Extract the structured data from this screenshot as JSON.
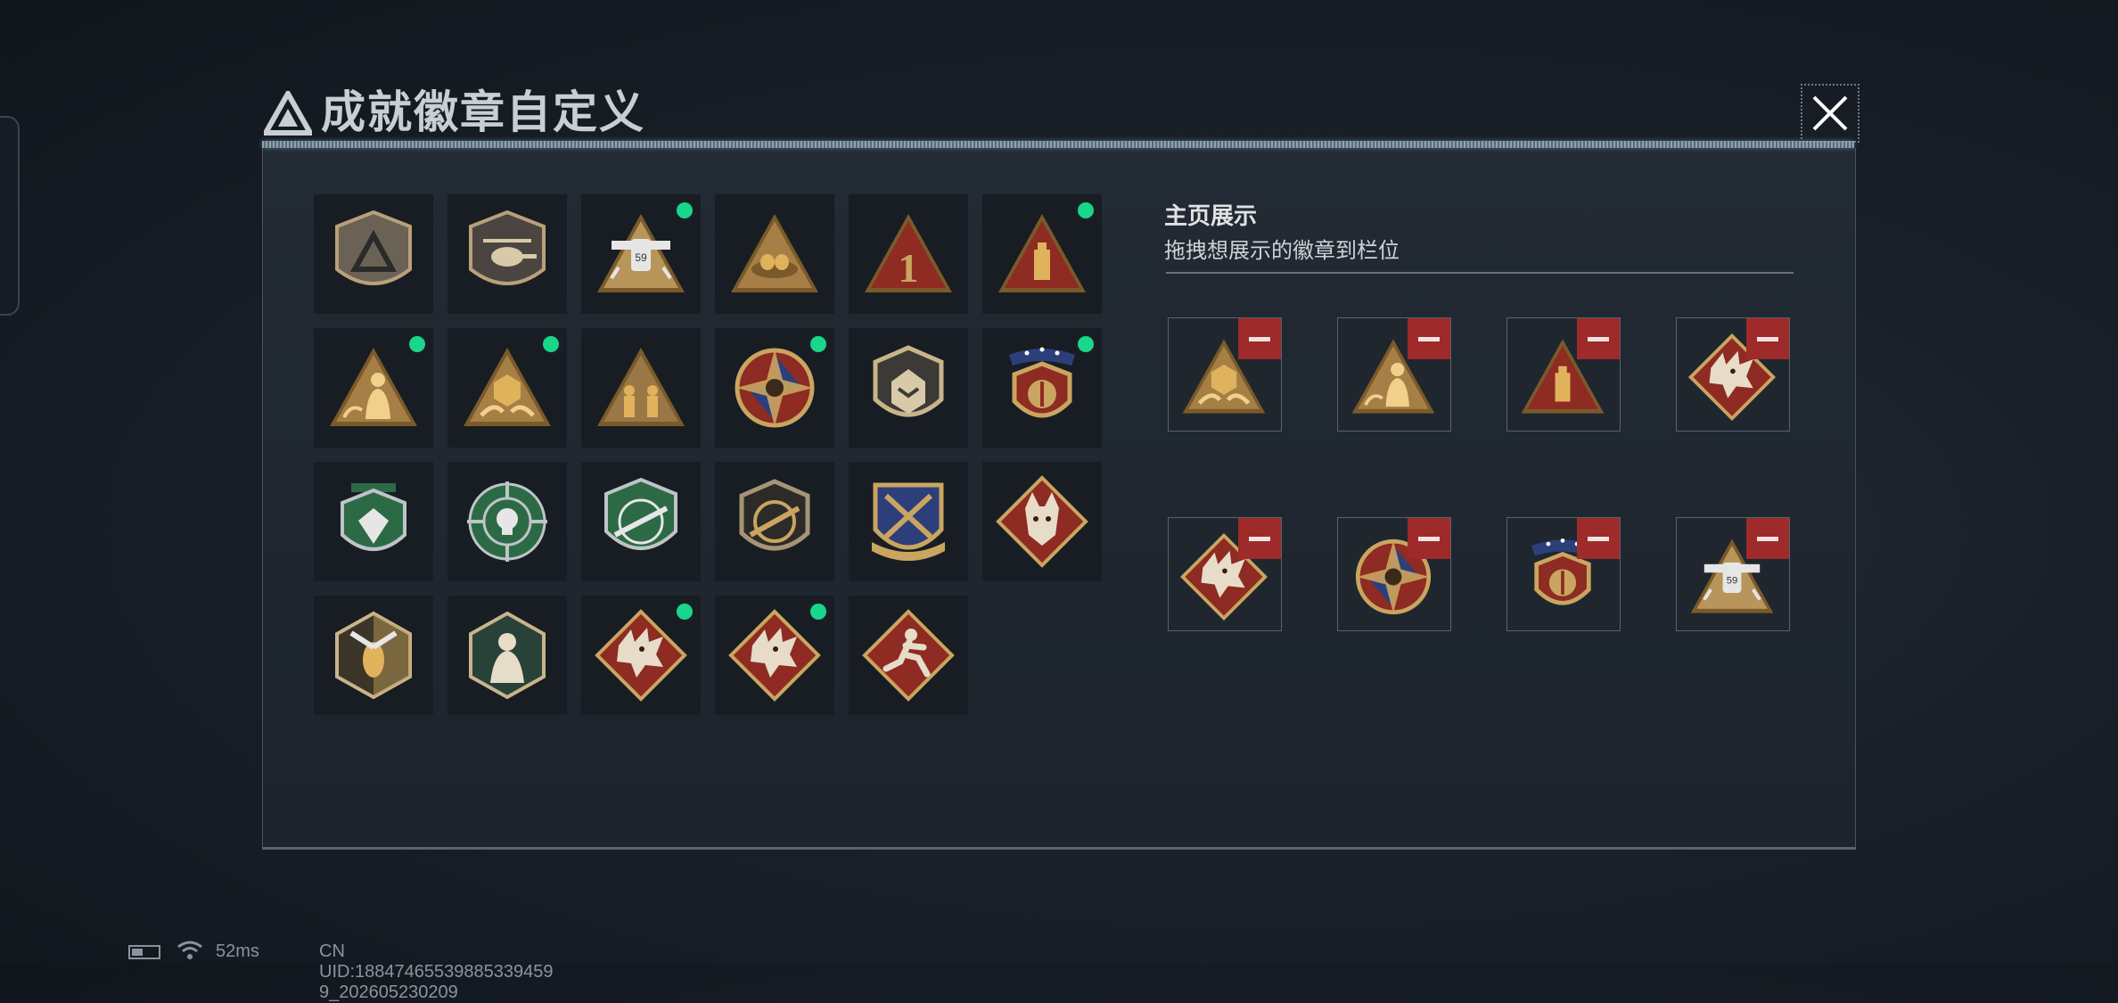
{
  "dialog": {
    "title": "成就徽章自定义",
    "close_icon": "close-icon"
  },
  "colors": {
    "new_indicator": "#19d68a",
    "remove_button": "#9e2a2a",
    "badge_gold": "#c9a560",
    "badge_red": "#8e2b22",
    "badge_green": "#2c6a46"
  },
  "badges": [
    {
      "icon": "gray-triangle-shield-badge",
      "new": false
    },
    {
      "icon": "helicopter-shield-badge",
      "new": false
    },
    {
      "icon": "robot-59-triangle-badge",
      "new": true
    },
    {
      "icon": "nest-triangle-badge",
      "new": false
    },
    {
      "icon": "number-one-triangle-badge",
      "new": false
    },
    {
      "icon": "drive-triangle-badge",
      "new": true
    },
    {
      "icon": "figure-triangle-badge",
      "new": true
    },
    {
      "icon": "hex-hands-triangle-badge",
      "new": true
    },
    {
      "icon": "soldiers-triangle-badge",
      "new": false
    },
    {
      "icon": "star-compass-badge",
      "new": true
    },
    {
      "icon": "rank-shield-badge",
      "new": false
    },
    {
      "icon": "laurel-ribbon-shield-badge",
      "new": true
    },
    {
      "icon": "green-diamond-shield-badge",
      "new": false
    },
    {
      "icon": "green-crosshair-skull-badge",
      "new": false
    },
    {
      "icon": "green-rifle-shield-badge",
      "new": false
    },
    {
      "icon": "rifle-shield-badge",
      "new": false
    },
    {
      "icon": "blue-crossed-weapons-badge",
      "new": false
    },
    {
      "icon": "wolf-diamond-badge",
      "new": false
    },
    {
      "icon": "wasp-hexagon-badge",
      "new": false
    },
    {
      "icon": "soldier-hexagon-badge",
      "new": false
    },
    {
      "icon": "dragon-diamond-badge",
      "new": true
    },
    {
      "icon": "dragon-diamond-badge",
      "new": true
    },
    {
      "icon": "runner-diamond-badge",
      "new": false
    }
  ],
  "display": {
    "title": "主页展示",
    "hint": "拖拽想展示的徽章到栏位",
    "slots": [
      {
        "icon": "hex-hands-triangle-badge"
      },
      {
        "icon": "figure-triangle-badge"
      },
      {
        "icon": "drive-triangle-badge"
      },
      {
        "icon": "dragon-diamond-badge"
      },
      {
        "icon": "dragon-diamond-badge"
      },
      {
        "icon": "star-compass-badge"
      },
      {
        "icon": "laurel-ribbon-shield-badge"
      },
      {
        "icon": "robot-59-triangle-badge"
      }
    ]
  },
  "status": {
    "ping": "52ms",
    "uid": "CN UID:18847465539885339459​9_202605230209"
  }
}
